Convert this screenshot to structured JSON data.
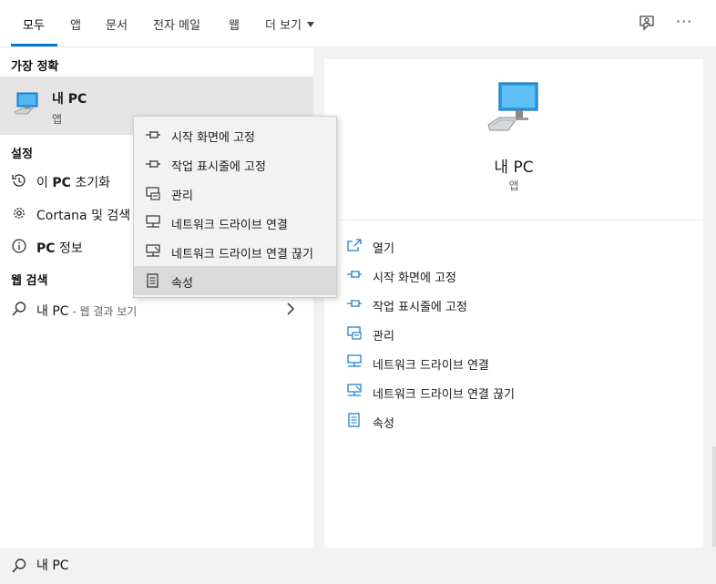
{
  "tabs": [
    {
      "label": "모두",
      "active": true
    },
    {
      "label": "앱"
    },
    {
      "label": "문서"
    },
    {
      "label": "전자 메일"
    },
    {
      "label": "웹"
    },
    {
      "label": "더 보기"
    }
  ],
  "top_icons": [
    "feedback-icon",
    "more-options-icon"
  ],
  "more_glyph": "···",
  "best_match": {
    "section": "가장 정확",
    "name": "내 PC",
    "type": "앱",
    "icon": "computer-icon"
  },
  "settings": {
    "section": "설정",
    "items": [
      {
        "prefix": "이 ",
        "bold": "PC",
        "suffix": " 초기화",
        "icon": "reset-icon"
      },
      {
        "prefix": "Cortana 및 검색",
        "bold": "",
        "suffix": "",
        "icon": "gear-icon"
      },
      {
        "prefix": "",
        "bold": "PC",
        "suffix": " 정보",
        "icon": "info-icon"
      }
    ]
  },
  "web_search": {
    "section": "웹 검색",
    "query": "내 PC",
    "suffix": " - 웹 결과 보기",
    "icon": "search-icon"
  },
  "context_menu": [
    {
      "label": "시작 화면에 고정",
      "icon": "pin-icon"
    },
    {
      "label": "작업 표시줄에 고정",
      "icon": "pin-icon"
    },
    {
      "label": "관리",
      "icon": "manage-icon"
    },
    {
      "label": "네트워크 드라이브 연결",
      "icon": "network-drive-icon"
    },
    {
      "label": "네트워크 드라이브 연결 끊기",
      "icon": "network-drive-disconnect-icon"
    },
    {
      "label": "속성",
      "icon": "properties-icon",
      "highlighted": true
    }
  ],
  "detail": {
    "name": "내 PC",
    "type": "앱",
    "actions": [
      {
        "label": "열기",
        "icon": "open-icon"
      },
      {
        "label": "시작 화면에 고정",
        "icon": "pin-icon"
      },
      {
        "label": "작업 표시줄에 고정",
        "icon": "pin-icon"
      },
      {
        "label": "관리",
        "icon": "manage-icon"
      },
      {
        "label": "네트워크 드라이브 연결",
        "icon": "network-drive-icon"
      },
      {
        "label": "네트워크 드라이브 연결 끊기",
        "icon": "network-drive-disconnect-icon"
      },
      {
        "label": "속성",
        "icon": "properties-icon"
      }
    ]
  },
  "search_box": {
    "value": "내 PC",
    "icon": "search-icon"
  },
  "colors": {
    "accent": "#0078d7",
    "highlight": "#e5e5e5",
    "menu_bg": "#f2f2f2"
  }
}
